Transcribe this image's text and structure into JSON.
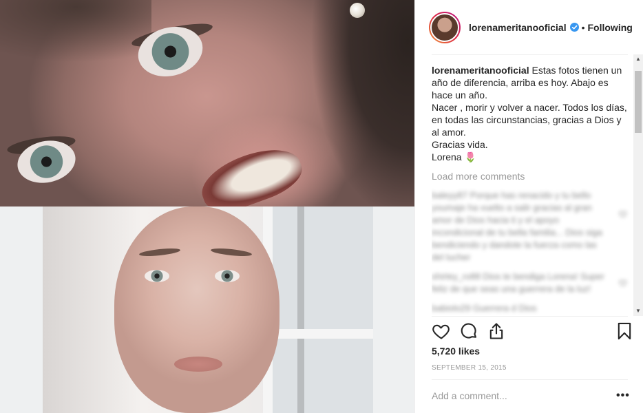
{
  "photo": {
    "top_alt": "Close-up face photo",
    "bottom_alt": "Portrait photo without hair"
  },
  "header": {
    "username": "lorenameritanooficial",
    "separator": "•",
    "follow_status": "Following"
  },
  "caption": {
    "username": "lorenameritanooficial",
    "lines": [
      "Estas fotos tienen un año de diferencia, arriba es hoy. Abajo es hace un año.",
      "Nacer , morir y volver a nacer. Todos los días, en todas las circunstancias, gracias a Dios y al amor.",
      "Gracias vida.",
      "Lorena 🌷"
    ]
  },
  "comments": {
    "load_more": "Load more comments",
    "blurred": [
      "baleyy87 Porque has renacido y tu bello youmaje ha vuelto a salir gracias al gran amor de Dios hacia ti y el apoyo incondicional de tu bella familia... Dios siga bendiciendo y dandote la fuerza como las del lucher",
      "shirley_ro88 Dios te bendiga Lorena! Super feliz de que seas una guerrera de la luz!",
      "babiolo29 Guerrera d Dios"
    ]
  },
  "actions": {
    "like_icon": "heart-icon",
    "comment_icon": "comment-bubble-icon",
    "share_icon": "share-icon",
    "save_icon": "bookmark-icon"
  },
  "likes": "5,720 likes",
  "date": "SEPTEMBER 15, 2015",
  "add_comment": {
    "placeholder": "Add a comment...",
    "more": "•••"
  },
  "colors": {
    "verified": "#3897f0",
    "muted_text": "#999999",
    "text": "#262626"
  }
}
